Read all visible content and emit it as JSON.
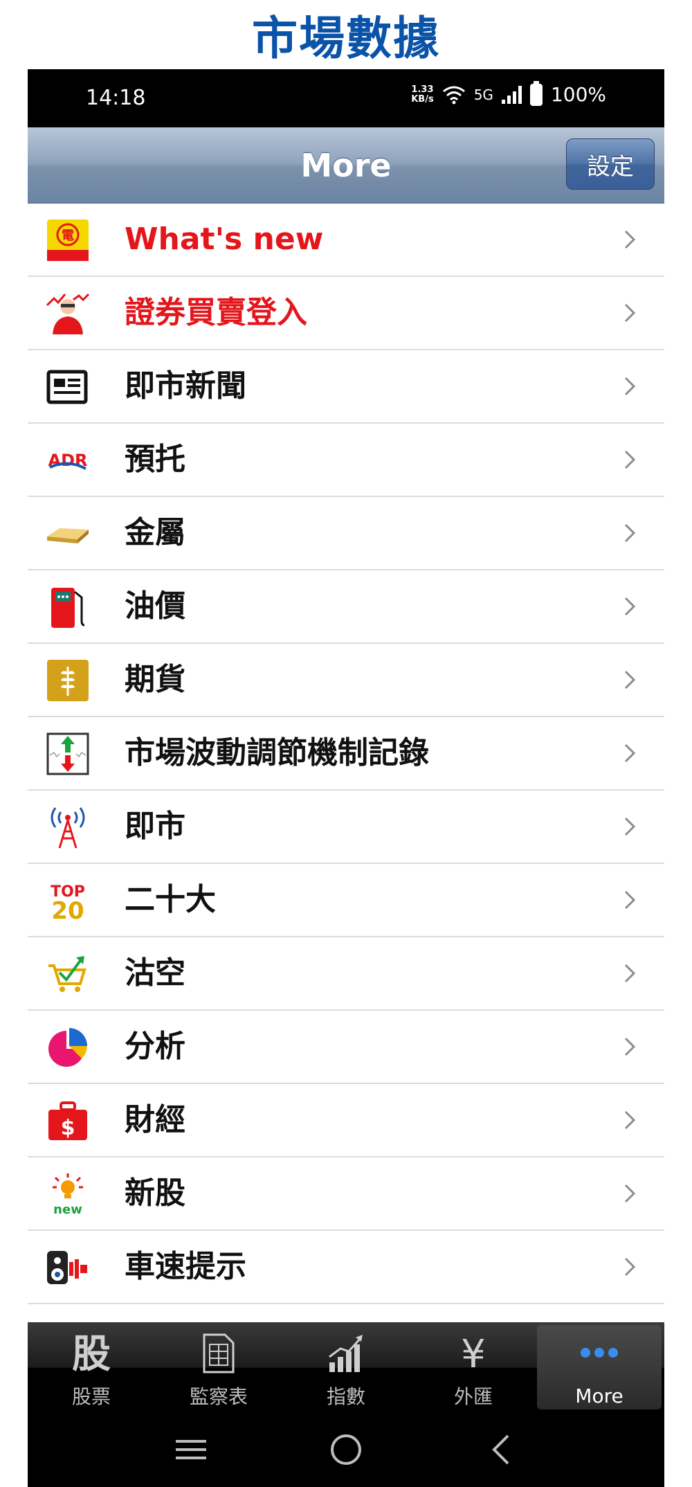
{
  "caption": "市場數據",
  "status": {
    "time": "14:18",
    "netspeed_top": "1.33",
    "netspeed_bottom": "KB/s",
    "network": "5G",
    "battery": "100%"
  },
  "navbar": {
    "title": "More",
    "settings_label": "設定"
  },
  "menu": {
    "items": [
      {
        "label": "What's new",
        "icon": "telecom-pro-icon",
        "highlight": true
      },
      {
        "label": "證券買賣登入",
        "icon": "trader-icon",
        "highlight": true
      },
      {
        "label": "即市新聞",
        "icon": "newspaper-icon",
        "highlight": false
      },
      {
        "label": "預托",
        "icon": "adr-icon",
        "highlight": false
      },
      {
        "label": "金屬",
        "icon": "gold-bar-icon",
        "highlight": false
      },
      {
        "label": "油價",
        "icon": "fuel-pump-icon",
        "highlight": false
      },
      {
        "label": "期貨",
        "icon": "wheat-icon",
        "highlight": false
      },
      {
        "label": "市場波動調節機制記錄",
        "icon": "volatility-icon",
        "highlight": false
      },
      {
        "label": "即市",
        "icon": "broadcast-tower-icon",
        "highlight": false
      },
      {
        "label": "二十大",
        "icon": "top20-icon",
        "highlight": false
      },
      {
        "label": "沽空",
        "icon": "shopping-cart-trend-icon",
        "highlight": false
      },
      {
        "label": "分析",
        "icon": "pie-chart-icon",
        "highlight": false
      },
      {
        "label": "財經",
        "icon": "money-bag-icon",
        "highlight": false
      },
      {
        "label": "新股",
        "icon": "new-bulb-icon",
        "highlight": false
      },
      {
        "label": "車速提示",
        "icon": "speaker-icon",
        "highlight": false
      }
    ]
  },
  "icon_text": {
    "top": "TOP",
    "twenty": "20",
    "new": "new",
    "dollar": "$",
    "adr": "ADR",
    "telecom": "電"
  },
  "tabbar": {
    "tabs": [
      {
        "label": "股票",
        "glyph": "股"
      },
      {
        "label": "監察表",
        "glyph": ""
      },
      {
        "label": "指數",
        "glyph": ""
      },
      {
        "label": "外匯",
        "glyph": "¥"
      },
      {
        "label": "More",
        "glyph": ""
      }
    ],
    "active_index": 4
  },
  "colors": {
    "caption": "#0a53a8",
    "highlight": "#e4161c",
    "navbar": "#8ea2bb"
  }
}
